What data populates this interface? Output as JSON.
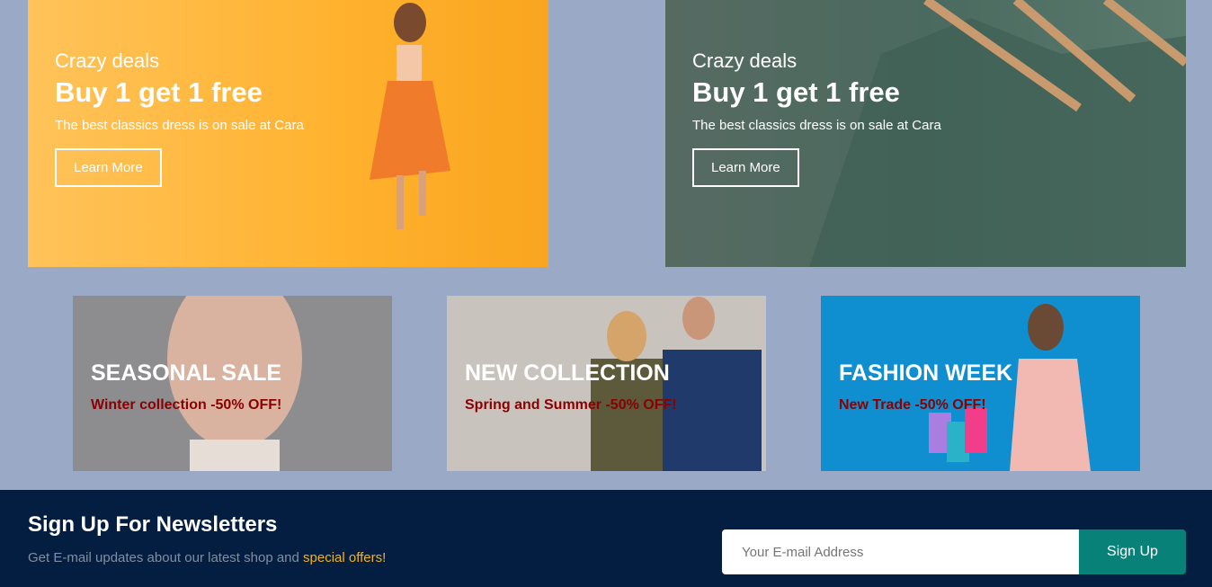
{
  "banners": [
    {
      "subtitle": "Crazy deals",
      "title": "Buy 1 get 1 free",
      "text": "The best classics dress is on sale at Cara",
      "button": "Learn More"
    },
    {
      "subtitle": "Crazy deals",
      "title": "Buy 1 get 1 free",
      "text": "The best classics dress is on sale at Cara",
      "button": "Learn More"
    }
  ],
  "promos": [
    {
      "title": "SEASONAL SALE",
      "text": "Winter collection -50% OFF!"
    },
    {
      "title": "NEW COLLECTION",
      "text": "Spring and Summer -50% OFF!"
    },
    {
      "title": "FASHION WEEK",
      "text": "New Trade -50% OFF!"
    }
  ],
  "newsletter": {
    "title": "Sign Up For Newsletters",
    "text": "Get E-mail updates about our latest shop and ",
    "highlight": "special offers!",
    "placeholder": "Your E-mail Address",
    "button": "Sign Up"
  }
}
